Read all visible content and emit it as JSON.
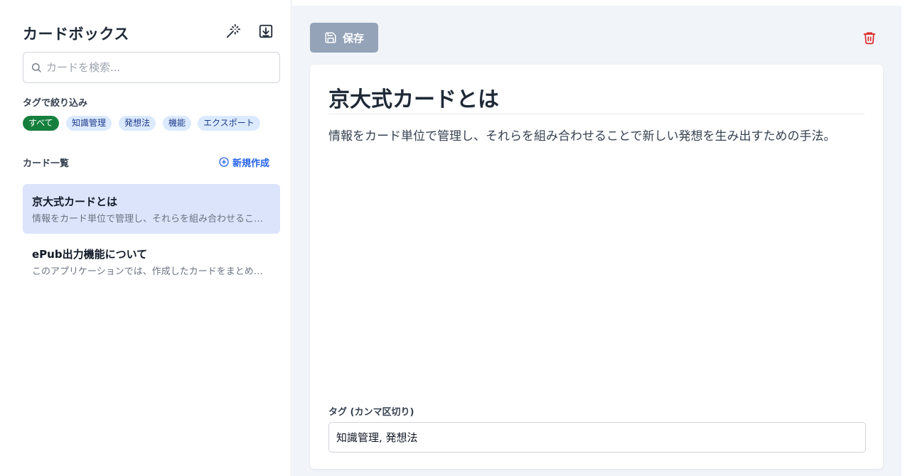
{
  "sidebar": {
    "title": "カードボックス",
    "search": {
      "placeholder": "カードを検索...",
      "value": ""
    },
    "filter_label": "タグで絞り込み",
    "tags": [
      "すべて",
      "知識管理",
      "発想法",
      "機能",
      "エクスポート"
    ],
    "active_tag": "すべて",
    "list_label": "カード一覧",
    "new_button": "新規作成",
    "cards": [
      {
        "title": "京大式カードとは",
        "preview": "情報をカード単位で管理し、それらを組み合わせることで新しい発想を生み出すための手法。"
      },
      {
        "title": "ePub出力機能について",
        "preview": "このアプリケーションでは、作成したカードをまとめてePub形式で出力できます。"
      }
    ]
  },
  "toolbar": {
    "save_label": "保存"
  },
  "editor": {
    "title": "京大式カードとは",
    "body": "情報をカード単位で管理し、それらを組み合わせることで新しい発想を生み出すための手法。",
    "tag_label": "タグ (カンマ区切り)",
    "tags_value": "知識管理, 発想法"
  },
  "colors": {
    "accent": "#2563eb",
    "active_tag": "#15803d",
    "tag_bg": "#dbeafe",
    "selected_card": "#dbe4fb",
    "save_button": "#94a3b8",
    "delete": "#dc2626",
    "main_bg": "#f1f4f8"
  },
  "icons": {
    "wand": "magic-wand-icon",
    "download": "download-icon",
    "search": "search-icon",
    "plus": "plus-circle-icon",
    "save": "save-icon",
    "delete": "trash-icon"
  }
}
